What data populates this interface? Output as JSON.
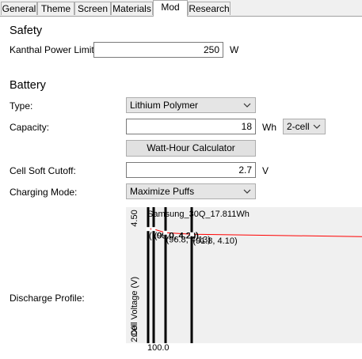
{
  "tabs": [
    {
      "label": "General",
      "active": false
    },
    {
      "label": "Theme",
      "active": false
    },
    {
      "label": "Screen",
      "active": false
    },
    {
      "label": "Materials",
      "active": false
    },
    {
      "label": "Mod",
      "active": true
    },
    {
      "label": "Research",
      "active": false
    }
  ],
  "safety": {
    "title": "Safety",
    "kanthal_label": "Kanthal Power Limit:",
    "kanthal_value": "250",
    "kanthal_unit": "W"
  },
  "battery": {
    "title": "Battery",
    "type_label": "Type:",
    "type_value": "Lithium Polymer",
    "capacity_label": "Capacity:",
    "capacity_value": "18",
    "capacity_unit": "Wh",
    "cells_value": "2-cell",
    "calculator_button": "Watt-Hour Calculator",
    "cutoff_label": "Cell Soft Cutoff:",
    "cutoff_value": "2.7",
    "cutoff_unit": "V",
    "charging_label": "Charging Mode:",
    "charging_value": "Maximize Puffs",
    "discharge_label": "Discharge Profile:"
  },
  "chart_data": {
    "type": "line",
    "title": "Samsung_30Q_17.811Wh",
    "ylabel": "Cell Voltage (V)",
    "ylim": [
      2.0,
      4.5
    ],
    "y_ticks": [
      "4.50",
      "2.00"
    ],
    "x_tick": "100.0",
    "series": [
      {
        "values": [
          [
            100.0,
            4.2
          ],
          [
            99.0,
            4.2
          ],
          [
            96.8,
            4.13
          ],
          [
            91.8,
            4.1
          ]
        ],
        "color": "#ff0000"
      }
    ],
    "point_labels": [
      "(100.0, 4.20)",
      "(99.0, 4.20)",
      "(96.8, 4.13)",
      "(91.8, 4.10)"
    ]
  },
  "icons": {
    "dropdown": "chevron-down-icon"
  }
}
